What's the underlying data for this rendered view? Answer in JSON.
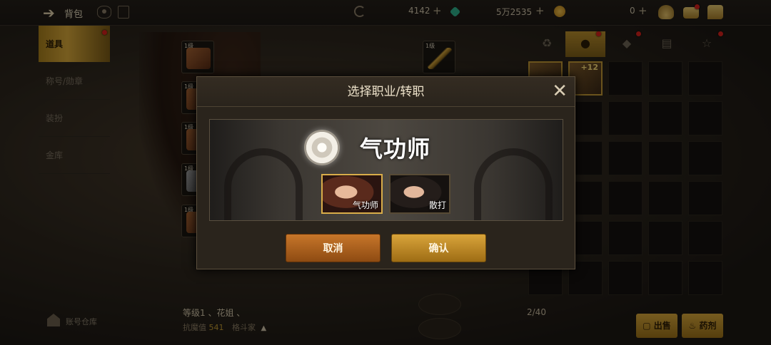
{
  "topbar": {
    "back_icon": "back-arrow-icon",
    "title": "背包",
    "currency1": "4142",
    "currency2": "5万2535",
    "currency3": "0"
  },
  "menu": {
    "items": [
      {
        "label": "道具"
      },
      {
        "label": "称号/勋章"
      },
      {
        "label": "装扮"
      },
      {
        "label": "金库"
      }
    ],
    "account_warehouse": "账号仓库"
  },
  "character": {
    "info": "等级1 、花姐 、",
    "resist_label": "抗魔值",
    "resist_value": "541",
    "class": "格斗家"
  },
  "inventory": {
    "count": "2/40",
    "item_badge": "+12",
    "sell_button": "出售",
    "potion_button": "药剂"
  },
  "modal": {
    "title": "选择职业/转职",
    "job_name": "气功师",
    "options": [
      {
        "label": "气功师"
      },
      {
        "label": "散打"
      }
    ],
    "cancel": "取消",
    "confirm": "确认"
  },
  "colors": {
    "accent_gold": "#d9a43a",
    "cancel_orange": "#c7762a",
    "notification_red": "#d6221d"
  }
}
